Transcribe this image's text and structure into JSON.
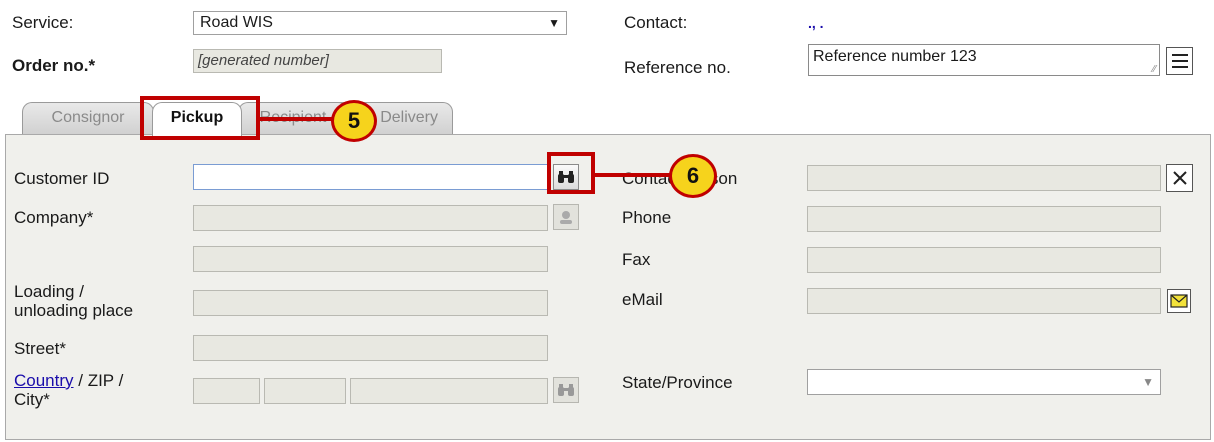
{
  "header": {
    "service_label": "Service:",
    "service_value": "Road WIS",
    "order_label": "Order no.*",
    "order_value": "[generated number]",
    "contact_label": "Contact:",
    "contact_value": ".,  .",
    "reference_label": "Reference no.",
    "reference_value": "Reference number 123"
  },
  "tabs": [
    {
      "label": "Consignor"
    },
    {
      "label": "Pickup"
    },
    {
      "label": "Recipient"
    },
    {
      "label": "Delivery"
    }
  ],
  "form": {
    "customer_id_label": "Customer ID",
    "company_label": "Company*",
    "loading_label_1": "Loading /",
    "loading_label_2": "unloading place",
    "street_label": "Street*",
    "country_link": "Country",
    "zip_city_label_1": " / ZIP /",
    "zip_city_label_2": "City*",
    "contact_person_label": "Contact person",
    "phone_label": "Phone",
    "fax_label": "Fax",
    "email_label": "eMail",
    "state_label": "State/Province"
  },
  "callouts": {
    "five": "5",
    "six": "6"
  },
  "colors": {
    "callout_red": "#c00000",
    "marker_yellow": "#f6d31c",
    "field_bg": "#e8e8e1",
    "panel_bg": "#f0f0ec"
  }
}
